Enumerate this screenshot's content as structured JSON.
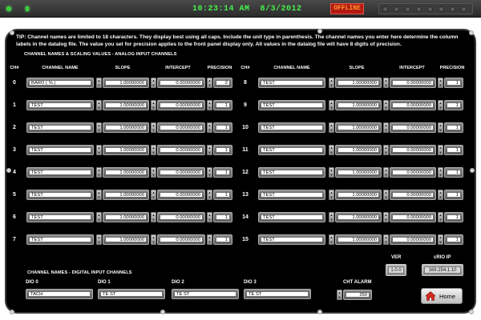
{
  "status": {
    "clock": "10:23:14 AM  8/3/2012",
    "offline_label": "OFFLINE"
  },
  "tip": "TIP: Channel names are limited to 18 characters.  They display best using all caps.  Include the unit type in parenthesis.  The channel names you enter here determine the column labels in the datalog file.  The value you set for precision applies to the front panel display only.  All values in the datalog file will have 8 digits of precision.",
  "analog": {
    "section_title": "CHANNEL NAMES & SCALING VALUES - ANALOG INPUT CHANNELS",
    "headers": {
      "ch": "CH#",
      "name": "CHANNEL NAME",
      "slope": "SLOPE",
      "intercept": "INTERCEPT",
      "precision": "PRECISION"
    },
    "channels": [
      {
        "ch": "0",
        "name": "BARO ( % )",
        "slope": "1.00000000",
        "intercept": "0.00000000",
        "precision": "2"
      },
      {
        "ch": "1",
        "name": "TEST",
        "slope": "1.00000000",
        "intercept": "0.00000000",
        "precision": "1"
      },
      {
        "ch": "2",
        "name": "TEST",
        "slope": "1.00000000",
        "intercept": "0.00000000",
        "precision": "1"
      },
      {
        "ch": "3",
        "name": "TEST",
        "slope": "1.00000000",
        "intercept": "0.00000000",
        "precision": "1"
      },
      {
        "ch": "4",
        "name": "TEST",
        "slope": "1.00000000",
        "intercept": "0.00000000",
        "precision": "1"
      },
      {
        "ch": "5",
        "name": "TEST",
        "slope": "1.00000000",
        "intercept": "0.00000000",
        "precision": "1"
      },
      {
        "ch": "6",
        "name": "TEST",
        "slope": "1.00000000",
        "intercept": "0.00000000",
        "precision": "1"
      },
      {
        "ch": "7",
        "name": "TEST",
        "slope": "1.00000000",
        "intercept": "0.00000000",
        "precision": "1"
      },
      {
        "ch": "8",
        "name": "TEST",
        "slope": "1.00000000",
        "intercept": "0.00000000",
        "precision": "1"
      },
      {
        "ch": "9",
        "name": "TEST",
        "slope": "1.00000000",
        "intercept": "0.00000000",
        "precision": "1"
      },
      {
        "ch": "10",
        "name": "TEST",
        "slope": "1.00000000",
        "intercept": "0.00000000",
        "precision": "1"
      },
      {
        "ch": "11",
        "name": "TEST",
        "slope": "1.00000000",
        "intercept": "0.00000000",
        "precision": "1"
      },
      {
        "ch": "12",
        "name": "TEST",
        "slope": "1.00000000",
        "intercept": "0.00000000",
        "precision": "1"
      },
      {
        "ch": "13",
        "name": "TEST",
        "slope": "1.00000000",
        "intercept": "0.00000000",
        "precision": "1"
      },
      {
        "ch": "14",
        "name": "TEST",
        "slope": "1.00000000",
        "intercept": "0.00000000",
        "precision": "1"
      },
      {
        "ch": "15",
        "name": "TEST",
        "slope": "1.00000000",
        "intercept": "0.00000000",
        "precision": "1"
      }
    ]
  },
  "digital": {
    "section_title": "CHANNEL NAMES - DIGITAL INPUT CHANNELS",
    "channels": [
      {
        "label": "DIO 0",
        "value": "TACH"
      },
      {
        "label": "DIO 1",
        "value": "TE ST"
      },
      {
        "label": "DIO 2",
        "value": "TE ST"
      },
      {
        "label": "DIO 3",
        "value": "TE ST"
      }
    ]
  },
  "cht_alarm": {
    "label": "CHT ALARM",
    "value": "250"
  },
  "version": {
    "label": "VER",
    "value": "1.0.0"
  },
  "crio_ip": {
    "label": "cRIO IP",
    "value": "169.254.1.10"
  },
  "home_button": {
    "label": "Home"
  }
}
